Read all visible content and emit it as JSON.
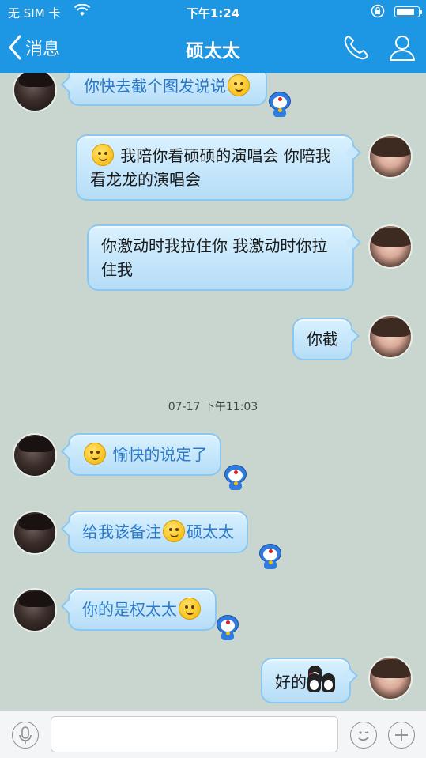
{
  "status_bar": {
    "carrier": "无 SIM 卡",
    "time": "下午1:24"
  },
  "nav": {
    "back_label": "消息",
    "title": "硕太太"
  },
  "messages": [
    {
      "text": "你快去截个图发说说"
    },
    {
      "text": "我陪你看硕硕的演唱会 你陪我看龙龙的演唱会"
    },
    {
      "text": "你激动时我拉住你 我激动时你拉住我"
    },
    {
      "text": "你截"
    },
    {
      "text": "愉快的说定了"
    },
    {
      "text_a": "给我该备注",
      "text_b": "硕太太"
    },
    {
      "text": "你的是权太太"
    },
    {
      "text": "好的"
    }
  ],
  "timestamp": "07-17 下午11:03",
  "input": {
    "placeholder": ""
  },
  "colors": {
    "brand": "#1d97e3",
    "chat_bg": "#c8d6cf",
    "bubble": "#b5ddf7",
    "incoming_text": "#2b78c8"
  },
  "icons": [
    "back-chevron-icon",
    "phone-icon",
    "profile-icon",
    "microphone-icon",
    "emoji-icon",
    "plus-icon"
  ]
}
